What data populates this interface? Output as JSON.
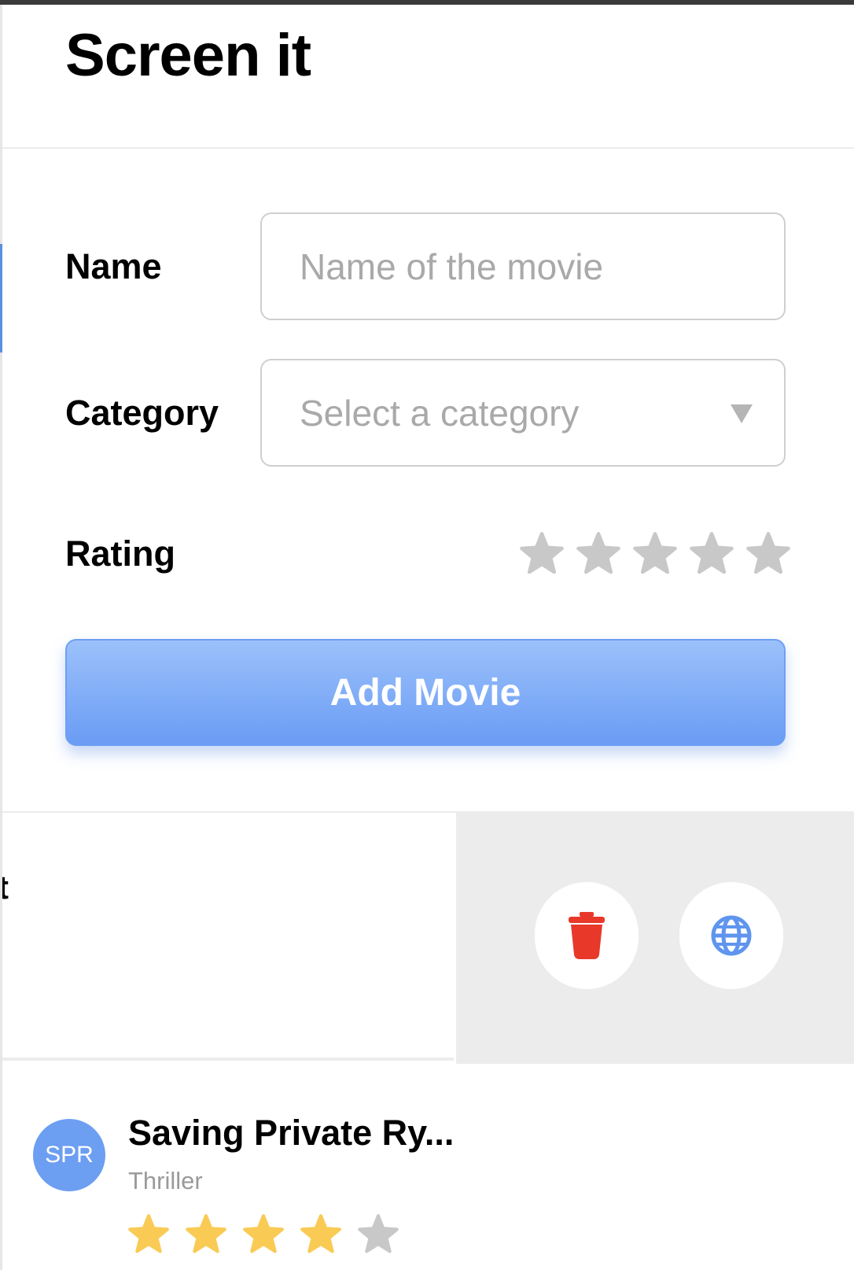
{
  "header": {
    "title": "Screen it"
  },
  "form": {
    "name_label": "Name",
    "name_placeholder": "Name of the movie",
    "category_label": "Category",
    "category_placeholder": "Select a category",
    "rating_label": "Rating",
    "rating_value": 0,
    "rating_max": 5,
    "submit_label": "Add Movie"
  },
  "swiped_item": {
    "title_fragment": "t",
    "actions": [
      {
        "icon": "trash-icon",
        "color": "#e8382a"
      },
      {
        "icon": "globe-icon",
        "color": "#5f95ef"
      }
    ]
  },
  "movies": [
    {
      "initials": "SPR",
      "title": "Saving Private Ry...",
      "category": "Thriller",
      "rating": 4,
      "rating_max": 5
    }
  ],
  "colors": {
    "accent": "#6c9ef2",
    "star_filled": "#f9cb55",
    "star_empty": "#c8c8c8",
    "delete": "#e8382a"
  }
}
